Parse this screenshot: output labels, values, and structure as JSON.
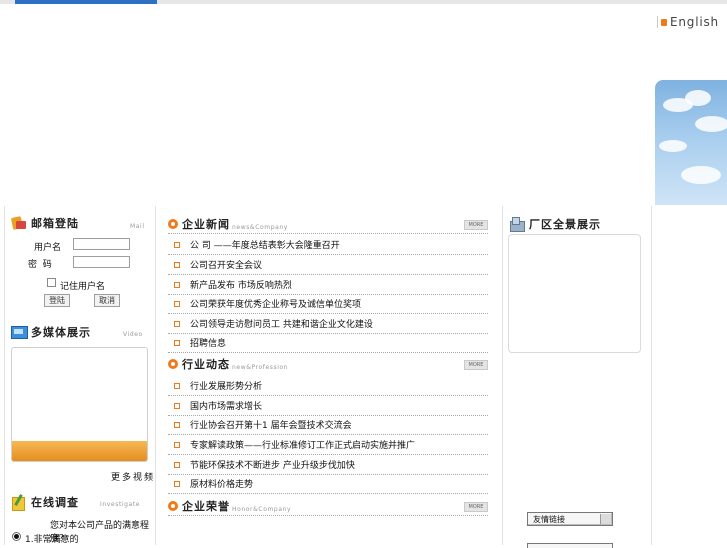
{
  "header": {
    "lang_link": "English"
  },
  "mail_login": {
    "title": "邮箱登陆",
    "subtitle": "Mail",
    "username_label": "用户名",
    "password_label": "密  码",
    "remember_label": "记住用户名",
    "login_button": "登陆",
    "cancel_button": "取消"
  },
  "media": {
    "title": "多媒体展示",
    "subtitle": "Video",
    "caption": "更多视频"
  },
  "survey": {
    "title": "在线调查",
    "subtitle": "Investigate",
    "question": "您对本公司产品的满意程度？",
    "option_1": "1.非常满意的"
  },
  "company_news": {
    "title": "企业新闻",
    "subtitle": "news&Company",
    "more": "MORE",
    "items": [
      "公 司 ——年度总结表彰大会隆重召开",
      "公司召开安全会议",
      "新产品发布 市场反响热烈",
      "公司荣获年度优秀企业称号及诚信单位奖项",
      "公司领导走访慰问员工 共建和谐企业文化建设",
      "招聘信息"
    ]
  },
  "industry_news": {
    "title": "行业动态",
    "subtitle": "new&Profession",
    "more": "MORE",
    "items": [
      "行业发展形势分析",
      "国内市场需求增长",
      "行业协会召开第十1 届年会暨技术交流会",
      "专家解读政策——行业标准修订工作正式启动实施并推广",
      "节能环保技术不断进步 产业升级步伐加快",
      "原材料价格走势"
    ]
  },
  "honors": {
    "title": "企业荣誉",
    "subtitle": "Honor&Company",
    "more": "MORE"
  },
  "plant": {
    "title": "厂区全景展示",
    "select_value": "友情链接"
  }
}
